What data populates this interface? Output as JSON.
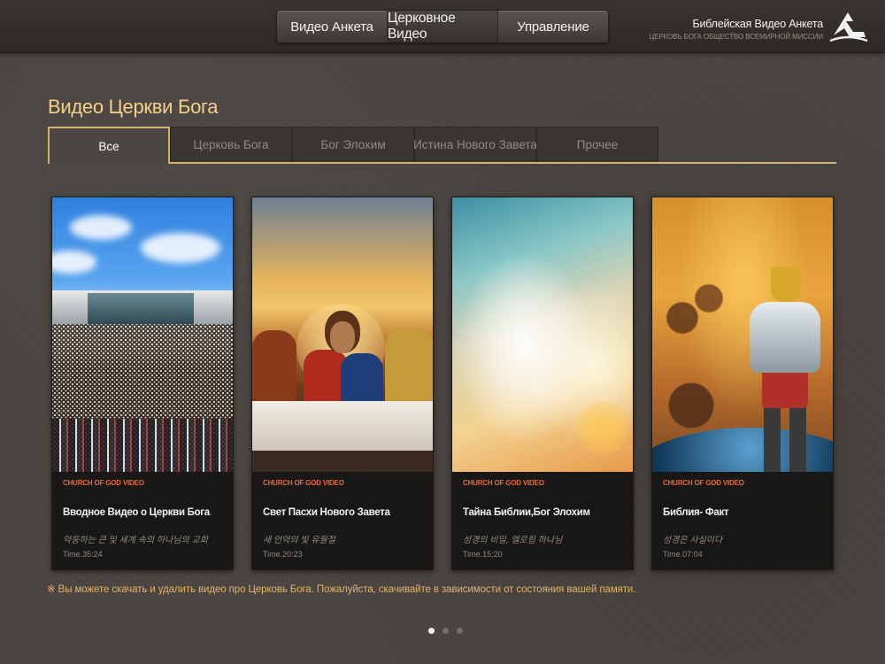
{
  "nav": {
    "items": [
      {
        "label": "Видео Анкета"
      },
      {
        "label": "Церковное Видео"
      },
      {
        "label": "Управление"
      }
    ]
  },
  "brand": {
    "title": "Библейская Видео Анкета",
    "subtitle": "ЦЕРКОВЬ БОГА ОБЩЕСТВО ВСЕМИРНОЙ МИССИИ",
    "logo_icon": "bible-logo-icon"
  },
  "page": {
    "title": "Видео Церкви Бога"
  },
  "tabs": [
    {
      "label": "Все"
    },
    {
      "label": "Церковь Бога"
    },
    {
      "label": "Бог Элохим"
    },
    {
      "label": "Истина Нового Завета"
    },
    {
      "label": "Прочее"
    }
  ],
  "cards": [
    {
      "tag": "CHURCH OF GOD VIDEO",
      "title": "Вводное Видео о Церкви Бога",
      "subtitle": "약동하는 큰 및 세계 속의 하나님의 교회",
      "time": "Time.35:24"
    },
    {
      "tag": "CHURCH OF GOD VIDEO",
      "title": "Свет Пасхи Нового Завета",
      "subtitle": "새 언약의 빛 유월절",
      "time": "Time.20:23"
    },
    {
      "tag": "CHURCH OF GOD VIDEO",
      "title": "Тайна Библии,Бог Элохим",
      "subtitle": "성경의 비밀, 엘로힘 하나님",
      "time": "Time.15:20"
    },
    {
      "tag": "CHURCH OF GOD VIDEO",
      "title": "Библия- Факт",
      "subtitle": "성경은 사실이다",
      "time": "Time.07:04"
    }
  ],
  "note": "※ Вы можете скачать и удалить видео про Церковь Бога. Пожалуйста, скачивайте в зависимости от состояния вашей памяти.",
  "pager": {
    "pages": 3,
    "current": 1
  },
  "colors": {
    "accent": "#d6b06c",
    "title": "#f4cf8a",
    "tag": "#e36a3a",
    "note": "#e3b36a"
  }
}
